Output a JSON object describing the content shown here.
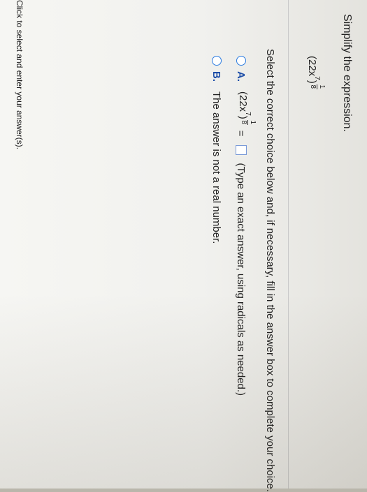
{
  "question": {
    "prompt": "Simplify the expression.",
    "expression": {
      "base": "(22x",
      "inner_exponent": "7",
      "close": ")",
      "outer_exponent_numerator": "1",
      "outer_exponent_denominator": "8"
    }
  },
  "instruction": "Select the correct choice below and, if necessary, fill in the answer box to complete your choice.",
  "choices": [
    {
      "letter": "A.",
      "lhs_base": "(22x",
      "lhs_inner_exponent": "7",
      "lhs_close": ")",
      "lhs_exp_num": "1",
      "lhs_exp_den": "8",
      "equals": "=",
      "hint": "(Type an exact answer, using radicals as needed.)",
      "answer_value": ""
    },
    {
      "letter": "B.",
      "text": "The answer is not a real number."
    }
  ],
  "footer": "Click to select and enter your answer(s).",
  "colors": {
    "accent": "#2a7be0",
    "letter": "#1f4fa8"
  }
}
